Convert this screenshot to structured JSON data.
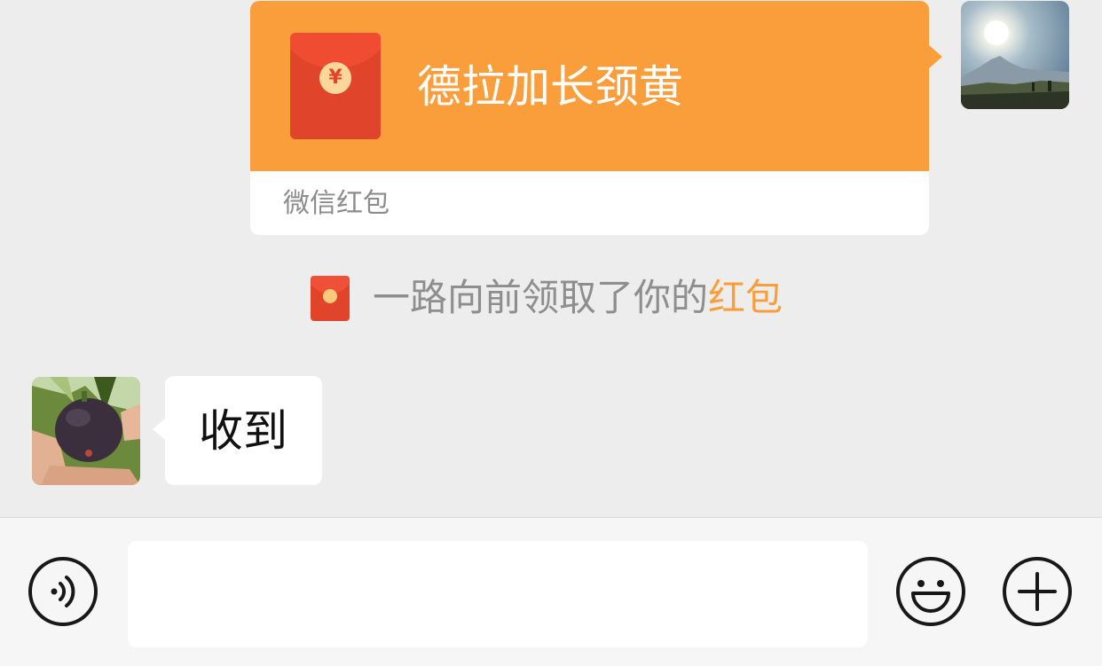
{
  "chat": {
    "red_packet": {
      "title": "德拉加长颈黄",
      "footer": "微信红包",
      "coin_symbol": "¥",
      "color_top": "#fa9d3b",
      "color_envelope": "#e0452b"
    },
    "system_notice": {
      "text": "一路向前领取了你的",
      "link_text": "红包",
      "link_color": "#fa9d3b"
    },
    "incoming_message": {
      "text": "收到"
    },
    "avatars": {
      "me": "landscape-sun-mountain-photo",
      "other": "fig-fruit-in-hand-photo"
    }
  },
  "input_bar": {
    "voice_icon": "voice-icon",
    "message_value": "",
    "message_placeholder": "",
    "emoji_icon": "emoji-icon",
    "more_icon": "plus-icon"
  }
}
